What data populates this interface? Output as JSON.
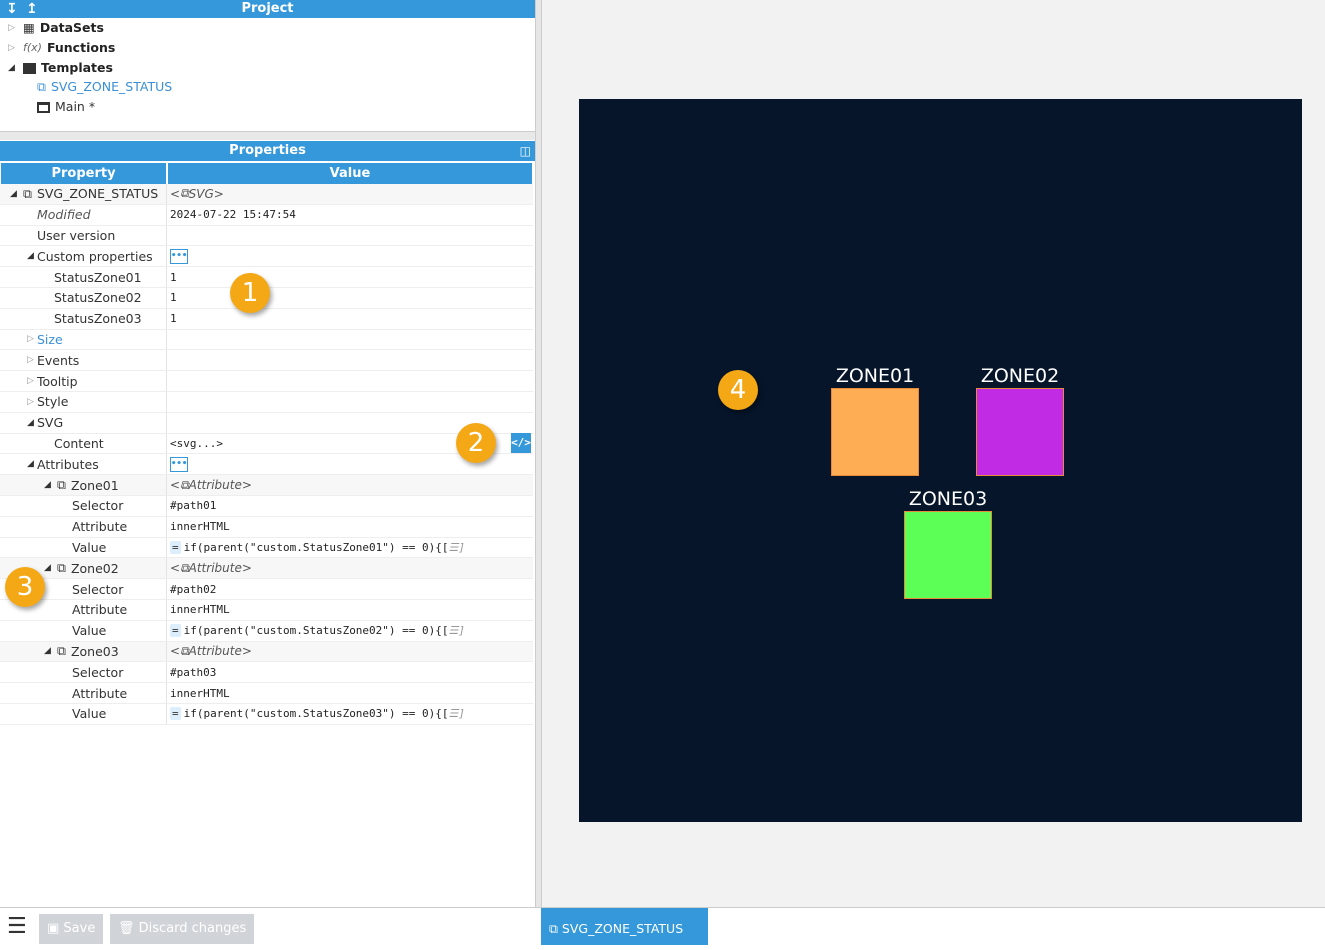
{
  "project": {
    "title": "Project",
    "items": [
      {
        "label": "DataSets",
        "icon": "table-icon",
        "expanded": false
      },
      {
        "label": "Functions",
        "icon": "function-icon",
        "expanded": false
      },
      {
        "label": "Templates",
        "icon": "window-icon",
        "expanded": true
      },
      {
        "label": "SVG_ZONE_STATUS",
        "icon": "template-icon"
      },
      {
        "label": "Main *",
        "icon": "window-icon"
      }
    ]
  },
  "properties": {
    "title": "Properties",
    "col_property": "Property",
    "col_value": "Value",
    "rows": [
      {
        "label": "SVG_ZONE_STATUS",
        "level": 0,
        "tri": "open",
        "icon": true,
        "value": "SVG",
        "value_type": "object"
      },
      {
        "label": "Modified",
        "level": 1,
        "italic": true,
        "value": "2024-07-22 15:47:54"
      },
      {
        "label": "User version",
        "level": 1,
        "value": ""
      },
      {
        "label": "Custom properties",
        "level": 1,
        "tri": "open",
        "value_type": "dots"
      },
      {
        "label": "StatusZone01",
        "level": 2,
        "value": "1"
      },
      {
        "label": "StatusZone02",
        "level": 2,
        "value": "1"
      },
      {
        "label": "StatusZone03",
        "level": 2,
        "value": "1"
      },
      {
        "label": "Size",
        "level": 1,
        "tri": "closed",
        "link": true,
        "value": ""
      },
      {
        "label": "Events",
        "level": 1,
        "tri": "closed",
        "value": ""
      },
      {
        "label": "Tooltip",
        "level": 1,
        "tri": "closed",
        "value": ""
      },
      {
        "label": "Style",
        "level": 1,
        "tri": "closed",
        "value": ""
      },
      {
        "label": "SVG",
        "level": 1,
        "tri": "open",
        "value": ""
      },
      {
        "label": "Content",
        "level": 2,
        "value": "<svg...>",
        "value_type": "code"
      },
      {
        "label": "Attributes",
        "level": 1,
        "tri": "open",
        "value_type": "dots"
      },
      {
        "label": "Zone01",
        "level": 2,
        "tri": "open",
        "icon": true,
        "value": "Attribute",
        "value_type": "object"
      },
      {
        "label": "Selector",
        "level": 3,
        "value": "#path01"
      },
      {
        "label": "Attribute",
        "level": 3,
        "value": "innerHTML"
      },
      {
        "label": "Value",
        "level": 3,
        "value": "if(parent(\"custom.StatusZone01\") == 0){[",
        "value_type": "expr"
      },
      {
        "label": "Zone02",
        "level": 2,
        "tri": "open",
        "icon": true,
        "value": "Attribute",
        "value_type": "object"
      },
      {
        "label": "Selector",
        "level": 3,
        "value": "#path02"
      },
      {
        "label": "Attribute",
        "level": 3,
        "value": "innerHTML"
      },
      {
        "label": "Value",
        "level": 3,
        "value": "if(parent(\"custom.StatusZone02\") == 0){[",
        "value_type": "expr"
      },
      {
        "label": "Zone03",
        "level": 2,
        "tri": "open",
        "icon": true,
        "value": "Attribute",
        "value_type": "object"
      },
      {
        "label": "Selector",
        "level": 3,
        "value": "#path03"
      },
      {
        "label": "Attribute",
        "level": 3,
        "value": "innerHTML"
      },
      {
        "label": "Value",
        "level": 3,
        "value": "if(parent(\"custom.StatusZone03\") == 0){[",
        "value_type": "expr"
      }
    ]
  },
  "preview": {
    "background": "#06152a",
    "zones": [
      {
        "label": "ZONE01",
        "color": "#ffad55"
      },
      {
        "label": "ZONE02",
        "color": "#c12be3"
      },
      {
        "label": "ZONE03",
        "color": "#5cff55"
      }
    ]
  },
  "badges": [
    "1",
    "2",
    "3",
    "4"
  ],
  "footer": {
    "save_label": "Save",
    "discard_label": "Discard changes",
    "tab_label": "SVG_ZONE_STATUS"
  }
}
